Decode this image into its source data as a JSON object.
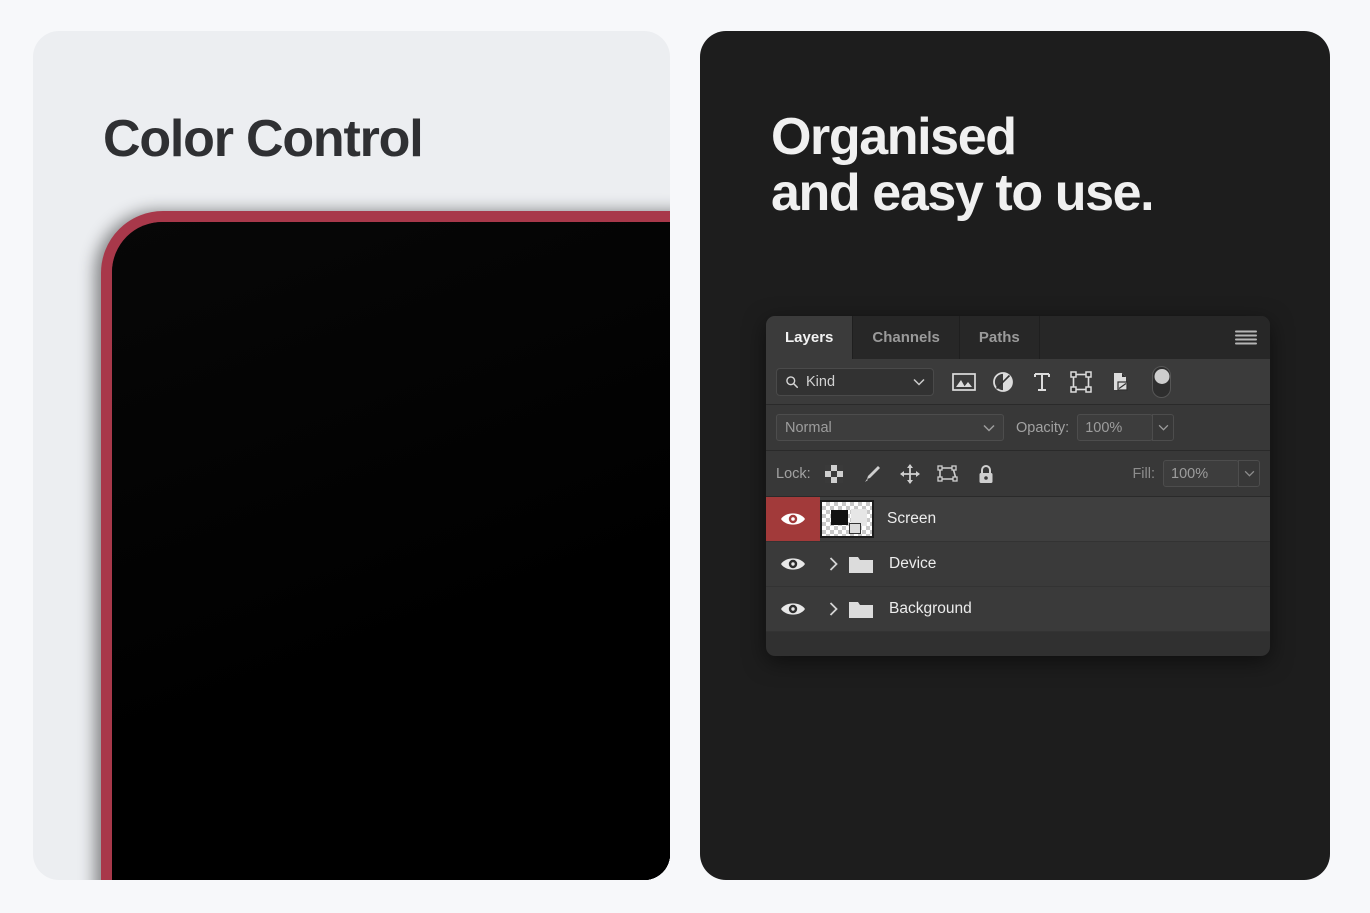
{
  "page": {
    "background_color": "#f7f8fa"
  },
  "left_card": {
    "background_color": "#eceef1",
    "title": "Color Control",
    "devices": [
      {
        "name": "device-frame-red",
        "color": "#a8384a"
      },
      {
        "name": "device-frame-yellow",
        "color": "#c6a03c"
      },
      {
        "name": "device-frame-green",
        "color": "#6fa078"
      },
      {
        "name": "device-frame-blue",
        "color": "#7aa7c2"
      }
    ]
  },
  "right_card": {
    "background_color": "#1d1d1d",
    "title": "Organised\nand easy to use."
  },
  "layers_panel": {
    "tabs": [
      {
        "label": "Layers",
        "active": true
      },
      {
        "label": "Channels",
        "active": false
      },
      {
        "label": "Paths",
        "active": false
      }
    ],
    "menu_icon": "hamburger-menu-icon",
    "filter_row": {
      "search_icon": "search-icon",
      "kind_value": "Kind",
      "dropdown_icon": "chevron-down-icon",
      "filter_icons": [
        "pixel-layer-filter-icon",
        "adjustment-layer-filter-icon",
        "type-layer-filter-icon",
        "shape-layer-filter-icon",
        "smart-object-filter-icon"
      ],
      "toggle_icon": "filter-enable-toggle"
    },
    "blend_row": {
      "blend_mode": "Normal",
      "blend_dropdown_icon": "chevron-down-icon",
      "opacity_label": "Opacity:",
      "opacity_value": "100%",
      "opacity_caret_icon": "chevron-down-icon"
    },
    "lock_row": {
      "lock_label": "Lock:",
      "lock_icons": [
        "lock-transparent-pixels-icon",
        "lock-image-pixels-icon",
        "lock-position-icon",
        "lock-artboard-nesting-icon",
        "lock-all-icon"
      ],
      "fill_label": "Fill:",
      "fill_value": "100%",
      "fill_caret_icon": "chevron-down-icon"
    },
    "layers": [
      {
        "name": "Screen",
        "type": "image",
        "selected": true,
        "visible": true,
        "visibility_icon": "eye-icon",
        "thumbnail": "transparency-checker-thumbnail",
        "selection_color": "#a23a3a"
      },
      {
        "name": "Device",
        "type": "group",
        "selected": false,
        "visible": true,
        "visibility_icon": "eye-icon",
        "disclosure_icon": "chevron-right-icon",
        "folder_icon": "folder-icon"
      },
      {
        "name": "Background",
        "type": "group",
        "selected": false,
        "visible": true,
        "visibility_icon": "eye-icon",
        "disclosure_icon": "chevron-right-icon",
        "folder_icon": "folder-icon"
      }
    ]
  }
}
